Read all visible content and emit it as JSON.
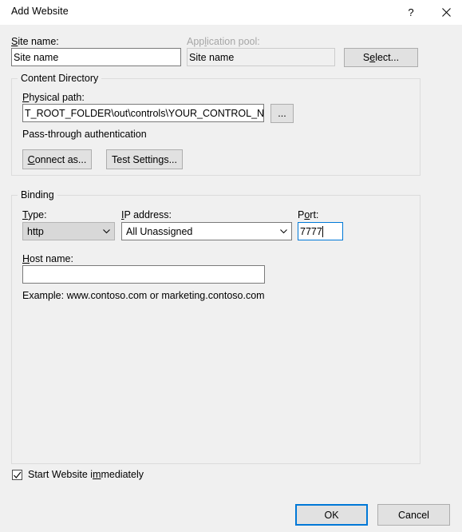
{
  "window": {
    "title": "Add Website",
    "help_icon": "question-mark-icon",
    "close_icon": "close-icon"
  },
  "site": {
    "site_name_label": "Site name:",
    "site_name_label_accel": "S",
    "site_name_value": "Site name",
    "app_pool_label": "Application pool:",
    "app_pool_label_accel": "l",
    "app_pool_value": "Site name",
    "select_button": "Select...",
    "select_button_accel": "e"
  },
  "content_directory": {
    "group_title": "Content Directory",
    "physical_path_label": "Physical path:",
    "physical_path_label_accel": "P",
    "physical_path_value": "T_ROOT_FOLDER\\out\\controls\\YOUR_CONTROL_NAME\\",
    "browse_button": "...",
    "pass_through_text": "Pass-through authentication",
    "connect_as_button": "Connect as...",
    "connect_as_accel": "C",
    "test_settings_button": "Test Settings...",
    "test_settings_accel": "g"
  },
  "binding": {
    "group_title": "Binding",
    "type_label": "Type:",
    "type_label_accel": "T",
    "type_value": "http",
    "ip_label": "IP address:",
    "ip_label_accel": "I",
    "ip_value": "All Unassigned",
    "port_label": "Port:",
    "port_label_accel": "o",
    "port_value": "7777",
    "host_label": "Host name:",
    "host_label_accel": "H",
    "host_value": "",
    "example_text": "Example: www.contoso.com or marketing.contoso.com"
  },
  "footer": {
    "start_website_label": "Start Website immediately",
    "start_website_accel": "m",
    "start_website_checked": true,
    "ok_button": "OK",
    "cancel_button": "Cancel"
  },
  "colors": {
    "accent": "#0078d7",
    "dialog_bg": "#f0f0f0",
    "titlebar_bg": "#ffffff",
    "button_face": "#e1e1e1",
    "disabled_text": "#a6a6a6"
  }
}
